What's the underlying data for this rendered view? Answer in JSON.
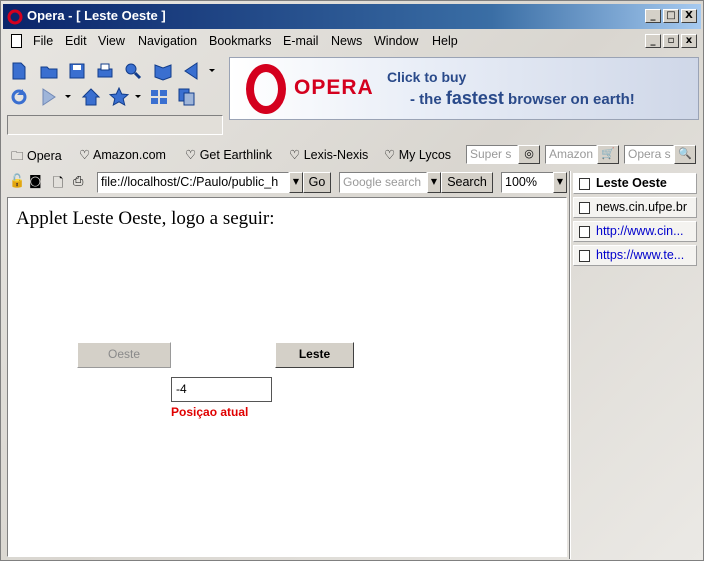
{
  "window": {
    "title": "Opera - [ Leste Oeste ]",
    "caption_min": "_",
    "caption_max": "□",
    "caption_close": "X"
  },
  "menu": {
    "items": [
      "File",
      "Edit",
      "View",
      "Navigation",
      "Bookmarks",
      "E-mail",
      "News",
      "Window",
      "Help"
    ]
  },
  "banner": {
    "brand": "OPERA",
    "line1": "Click to buy",
    "line2_prefix": "- the ",
    "line2_bold": "fastest",
    "line2_suffix": " browser on earth!"
  },
  "personal_bar": {
    "items": [
      "Opera",
      "Amazon.com",
      "Get Earthlink",
      "Lexis-Nexis",
      "My Lycos"
    ],
    "search1": "Super s",
    "search2": "Amazon",
    "search3": "Opera s"
  },
  "address_bar": {
    "url": "file://localhost/C:/Paulo/public_h",
    "go_label": "Go",
    "search_placeholder": "Google search",
    "search_button": "Search",
    "zoom": "100%"
  },
  "page": {
    "heading": "Applet Leste Oeste, logo a seguir:",
    "west_button": "Oeste",
    "east_button": "Leste",
    "position_value": "-4",
    "position_label": "Posiçao atual"
  },
  "side_panel": {
    "items": [
      {
        "label": "Leste Oeste",
        "kind": "page"
      },
      {
        "label": "news.cin.ufpe.br",
        "kind": "news"
      },
      {
        "label": "http://www.cin...",
        "kind": "link"
      },
      {
        "label": "https://www.te...",
        "kind": "link"
      }
    ]
  },
  "colors": {
    "title_bar": "#0a246a",
    "brand_red": "#d4001e",
    "position_label": "#e00000"
  }
}
